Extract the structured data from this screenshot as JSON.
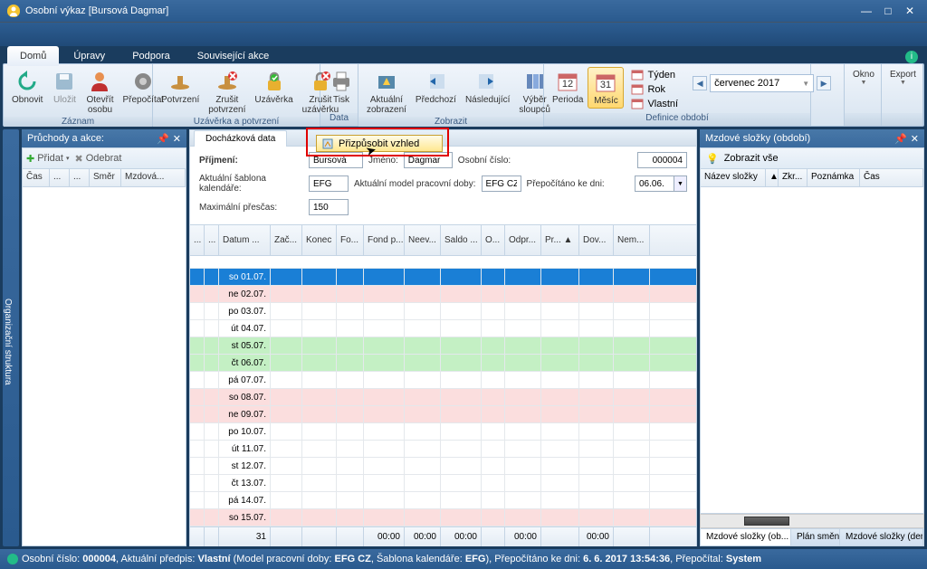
{
  "window": {
    "title": "Osobní výkaz [Bursová Dagmar]"
  },
  "tabs": {
    "active": "Domů",
    "items": [
      "Domů",
      "Úpravy",
      "Podpora",
      "Související akce"
    ]
  },
  "ribbon": {
    "zaznam": {
      "label": "Záznam",
      "obnovit": "Obnovit",
      "ulozit": "Uložit",
      "otevrit": "Otevřít\nosobu",
      "prepocitat": "Přepočítat"
    },
    "uzaverka": {
      "label": "Uzávěrka a potvrzení",
      "potvrzeni": "Potvrzení",
      "zrusit_potvrzeni": "Zrušit\npotvrzení",
      "uzaverka_btn": "Uzávěrka",
      "zrusit_uzaverku": "Zrušit\nuzávěrku"
    },
    "data": {
      "label": "Data",
      "tisk": "Tisk"
    },
    "zobrazit": {
      "label": "Zobrazit",
      "aktualni": "Aktuální\nzobrazení",
      "predchozi": "Předchozí",
      "nasledujici": "Následující",
      "vyber": "Výběr\nsloupců"
    },
    "obdobi": {
      "label": "Definice období",
      "perioda": "Perioda",
      "mesic": "Měsíc",
      "tyden": "Týden",
      "rok": "Rok",
      "vlastni": "Vlastní",
      "selected": "červenec 2017"
    },
    "right": {
      "okno": "Okno",
      "export": "Export"
    }
  },
  "vtab_left": "Organizační struktura",
  "left_panel": {
    "title": "Průchody a akce:",
    "pridat": "Přidat",
    "odebrat": "Odebrat",
    "cols": [
      "Čas",
      "...",
      "...",
      "Směr",
      "Mzdová..."
    ]
  },
  "center": {
    "tab": "Docházková data",
    "tooltip": "Přizpůsobit vzhled",
    "form": {
      "prijmeni_lbl": "Příjmení:",
      "prijmeni": "Bursová",
      "jmeno_lbl": "Jméno:",
      "jmeno": "Dagmar",
      "osobni_lbl": "Osobní číslo:",
      "osobni": "000004",
      "sablona_lbl": "Aktuální šablona kalendáře:",
      "sablona": "EFG",
      "model_lbl": "Aktuální model pracovní doby:",
      "model": "EFG CZ",
      "prepocitano_lbl": "Přepočítáno ke dni:",
      "prepocitano": "06.06.",
      "prescas_lbl": "Maximální přesčas:",
      "prescas": "150"
    },
    "cols": [
      "...",
      "...",
      "Datum ...",
      "Zač...",
      "Konec",
      "Fo...",
      "Fond p...",
      "Neev...",
      "Saldo ...",
      "O...",
      "Odpr...",
      "Pr... ▲",
      "Dov...",
      "Nem..."
    ],
    "rows": [
      {
        "date": "so 01.07.",
        "cls": "blue"
      },
      {
        "date": "ne 02.07.",
        "cls": "pink"
      },
      {
        "date": "po 03.07.",
        "cls": ""
      },
      {
        "date": "út 04.07.",
        "cls": ""
      },
      {
        "date": "st 05.07.",
        "cls": "green"
      },
      {
        "date": "čt 06.07.",
        "cls": "green"
      },
      {
        "date": "pá 07.07.",
        "cls": ""
      },
      {
        "date": "so 08.07.",
        "cls": "pink"
      },
      {
        "date": "ne 09.07.",
        "cls": "pink"
      },
      {
        "date": "po 10.07.",
        "cls": ""
      },
      {
        "date": "út 11.07.",
        "cls": ""
      },
      {
        "date": "st 12.07.",
        "cls": ""
      },
      {
        "date": "čt 13.07.",
        "cls": ""
      },
      {
        "date": "pá 14.07.",
        "cls": ""
      },
      {
        "date": "so 15.07.",
        "cls": "pink"
      }
    ],
    "footer": {
      "count": "31",
      "t1": "00:00",
      "t2": "00:00",
      "t3": "00:00",
      "t4": "00:00",
      "t5": "00:00"
    }
  },
  "right_panel": {
    "title": "Mzdové složky (období)",
    "zobrazit": "Zobrazit vše",
    "cols": [
      "Název složky",
      "▲",
      "Zkr...",
      "Poznámka",
      "Čas"
    ],
    "tabs": [
      "Mzdové složky (ob...",
      "Plán směn",
      "Mzdové složky (den)"
    ]
  },
  "statusbar": {
    "text_prefix": "Osobní číslo: ",
    "osobni": "000004",
    "text_mid": ", Aktuální předpis: ",
    "vlastni": "Vlastní",
    "text_detail": " (Model pracovní doby: ",
    "model": "EFG CZ",
    "text_sab": ", Šablona kalendáře: ",
    "sablona": "EFG",
    "text_prep": "), Přepočítáno ke dni: ",
    "datum": "6. 6. 2017 13:54:36",
    "text_by": ", Přepočítal: ",
    "system": "System"
  }
}
